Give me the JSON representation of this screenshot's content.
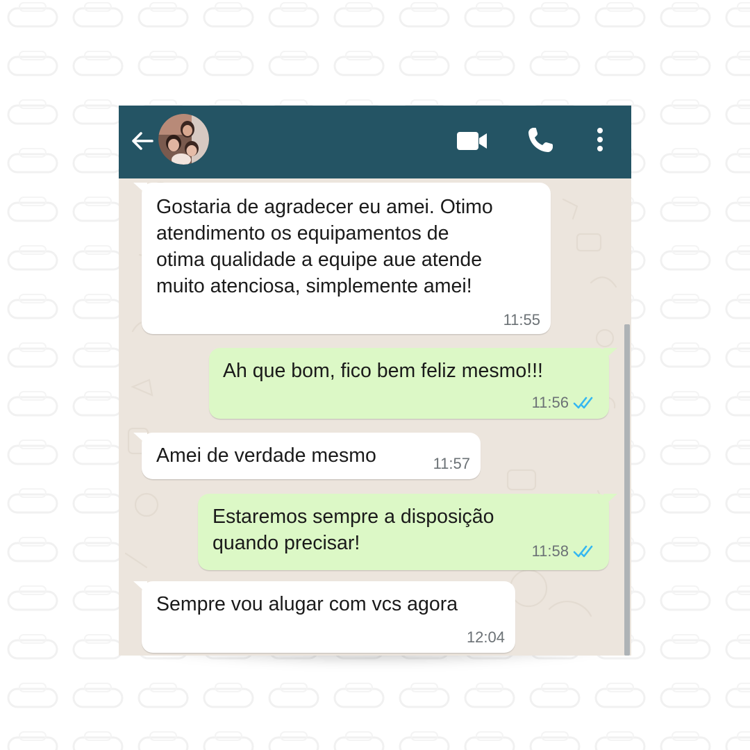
{
  "header": {
    "back_icon": "arrow-left-icon",
    "avatar": "contact-avatar",
    "video_icon": "video-camera-icon",
    "call_icon": "phone-icon",
    "menu_icon": "more-vertical-icon",
    "color": "#245464"
  },
  "messages": [
    {
      "direction": "incoming",
      "text": "Gostaria de agradecer eu amei. Otimo\natendimento os equipamentos de\notima qualidade a equipe aue atende\nmuito atenciosa, simplemente amei!",
      "time": "11:55"
    },
    {
      "direction": "outgoing",
      "text": "Ah que bom, fico bem feliz mesmo!!!",
      "time": "11:56",
      "status": "read"
    },
    {
      "direction": "incoming",
      "text": "Amei de verdade mesmo",
      "time": "11:57"
    },
    {
      "direction": "outgoing",
      "text": "Estaremos sempre a disposição\nquando precisar!",
      "time": "11:58",
      "status": "read"
    },
    {
      "direction": "incoming",
      "text": "Sempre vou alugar com vcs agora",
      "time": "12:04"
    }
  ],
  "colors": {
    "incoming_bubble": "#ffffff",
    "outgoing_bubble": "#dcf8c6",
    "chat_background": "#ece5dd",
    "read_ticks": "#34b7f1"
  }
}
